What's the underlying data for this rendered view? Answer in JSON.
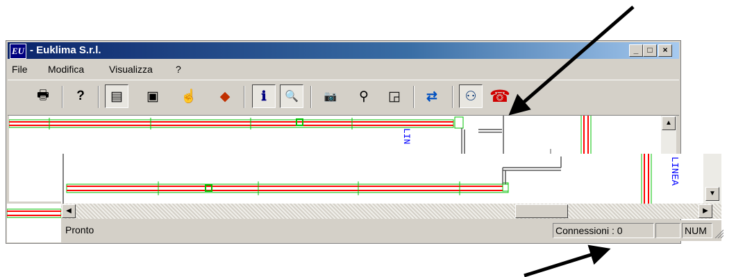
{
  "window": {
    "logo_text": "EU",
    "title": "- Euklima S.r.l.",
    "controls": {
      "minimize": "_",
      "maximize": "□",
      "close": "×"
    }
  },
  "menu": {
    "items": [
      "File",
      "Modifica",
      "Visualizza",
      "?"
    ]
  },
  "toolbar": {
    "buttons": [
      {
        "name": "print",
        "icon": "printer-icon",
        "glyph": "🖶"
      },
      {
        "name": "help",
        "icon": "help-question-icon",
        "glyph": "?"
      },
      {
        "name": "form",
        "icon": "form-edit-icon",
        "glyph": "▤"
      },
      {
        "name": "view",
        "icon": "monitor-icon",
        "glyph": "▣"
      },
      {
        "name": "pointer",
        "icon": "hand-pointer-icon",
        "glyph": "☝"
      },
      {
        "name": "objects",
        "icon": "shapes-icon",
        "glyph": "◆"
      },
      {
        "name": "info",
        "icon": "info-icon",
        "glyph": "ℹ"
      },
      {
        "name": "info-search",
        "icon": "info-search-icon",
        "glyph": "🔍"
      },
      {
        "name": "camera",
        "icon": "camera-icon",
        "glyph": "📷"
      },
      {
        "name": "find",
        "icon": "binoculars-icon",
        "glyph": "⚲"
      },
      {
        "name": "chart",
        "icon": "chart-icon",
        "glyph": "◲"
      },
      {
        "name": "swap",
        "icon": "swap-arrows-icon",
        "glyph": "⇄"
      },
      {
        "name": "network",
        "icon": "network-icon",
        "glyph": "⚇"
      },
      {
        "name": "phone",
        "icon": "telephone-icon",
        "glyph": "☎"
      }
    ]
  },
  "canvas": {
    "labels": {
      "top": "LIN",
      "right": "LINEA"
    }
  },
  "status": {
    "text": "Pronto",
    "connections": "Connessioni : 0",
    "num": "NUM"
  },
  "colors": {
    "title_start": "#0a246a",
    "title_end": "#a6caf0",
    "line_red": "#ff0000",
    "line_green": "#00c000",
    "label_blue": "#0000ff"
  }
}
